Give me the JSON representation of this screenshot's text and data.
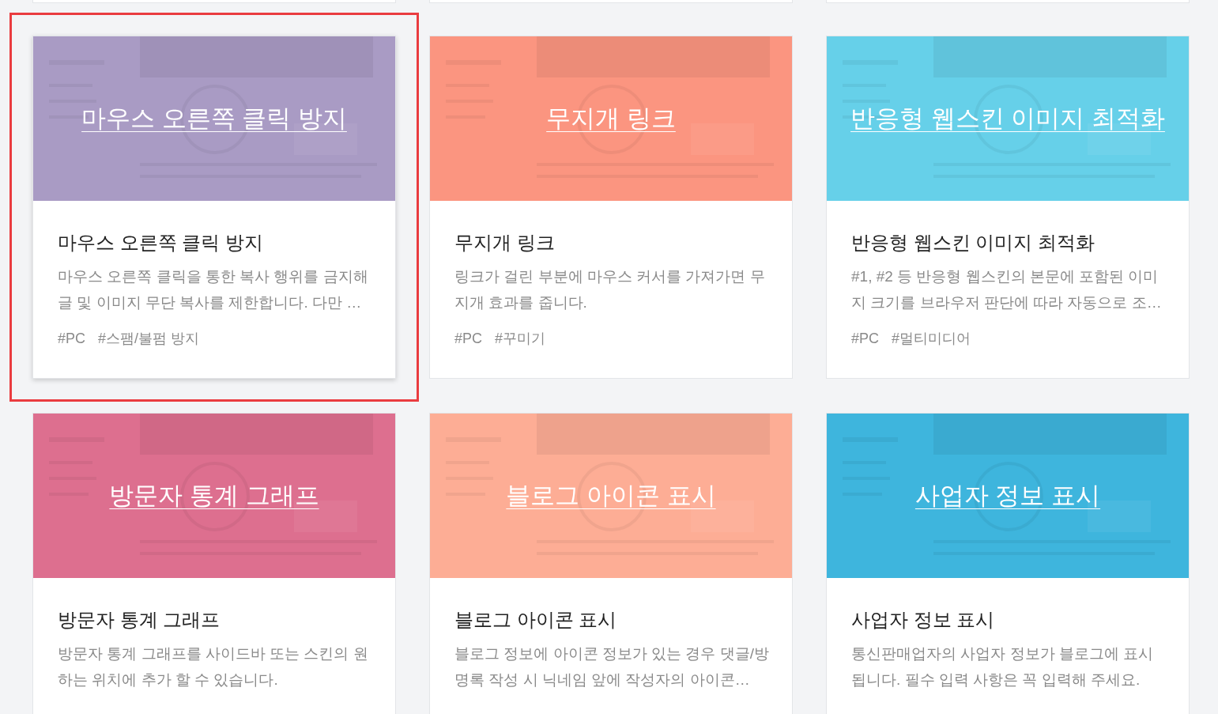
{
  "cards": [
    {
      "image_title": "마우스 오른쪽 클릭 방지",
      "color": "#a99bc4",
      "title": "마우스 오른쪽 클릭 방지",
      "description": "마우스 오른쪽 클릭을 통한 복사 행위를 금지해 글 및 이미지 무단 복사를 제한합니다. 다만 …",
      "tags": [
        "#PC",
        "#스팸/불펌 방지"
      ],
      "selected": true
    },
    {
      "image_title": "무지개 링크",
      "color": "#fb9580",
      "title": "무지개 링크",
      "description": "링크가 걸린 부분에 마우스 커서를 가져가면 무지개 효과를 줍니다.",
      "tags": [
        "#PC",
        "#꾸미기"
      ],
      "selected": false
    },
    {
      "image_title": "반응형 웹스킨 이미지 최적화",
      "color": "#66d0e9",
      "title": "반응형 웹스킨 이미지 최적화",
      "description": "#1, #2 등 반응형 웹스킨의 본문에 포함된 이미지 크기를 브라우저 판단에 따라 자동으로 조…",
      "tags": [
        "#PC",
        "#멀티미디어"
      ],
      "selected": false
    },
    {
      "image_title": "방문자 통계 그래프",
      "color": "#dd6f8f",
      "title": "방문자 통계 그래프",
      "description": "방문자 통계 그래프를 사이드바 또는 스킨의 원하는 위치에 추가 할 수 있습니다.",
      "selected": false
    },
    {
      "image_title": "블로그 아이콘 표시",
      "color": "#fdad95",
      "title": "블로그 아이콘 표시",
      "description": "블로그 정보에 아이콘 정보가 있는 경우 댓글/방명록 작성 시 닉네임 앞에 작성자의 아이콘…",
      "selected": false
    },
    {
      "image_title": "사업자 정보 표시",
      "color": "#3eb5dd",
      "title": "사업자 정보 표시",
      "description": "통신판매업자의 사업자 정보가 블로그에 표시됩니다. 필수 입력 사항은 꼭 입력해 주세요.",
      "selected": false
    }
  ]
}
